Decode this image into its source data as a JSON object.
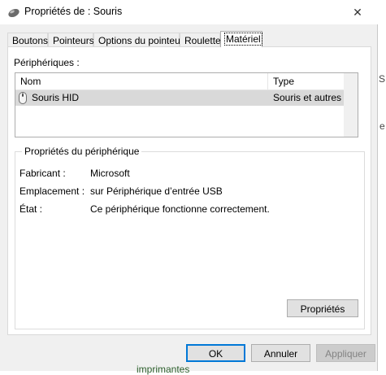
{
  "window": {
    "title": "Propriétés de : Souris",
    "close_glyph": "✕"
  },
  "tabs": [
    {
      "label": "Boutons",
      "active": false
    },
    {
      "label": "Pointeurs",
      "active": false
    },
    {
      "label": "Options du pointeur",
      "active": false
    },
    {
      "label": "Roulette",
      "active": false
    },
    {
      "label": "Matériel",
      "active": true
    }
  ],
  "devices": {
    "label": "Périphériques :",
    "columns": [
      "Nom",
      "Type"
    ],
    "rows": [
      {
        "name": "Souris HID",
        "type": "Souris et autres ...",
        "icon": "mouse-icon",
        "selected": true
      }
    ]
  },
  "properties": {
    "title": "Propriétés du périphérique",
    "fields": [
      {
        "key": "Fabricant :",
        "value": "Microsoft"
      },
      {
        "key": "Emplacement :",
        "value": "sur Périphérique d’entrée USB"
      },
      {
        "key": "État :",
        "value": "Ce périphérique fonctionne correctement."
      }
    ],
    "button": "Propriétés"
  },
  "footer": {
    "ok": "OK",
    "cancel": "Annuler",
    "apply": "Appliquer"
  },
  "background": {
    "fragment_1": "S",
    "fragment_2": "e",
    "fragment_3": "imprimantes"
  },
  "colors": {
    "accent": "#0078d7",
    "selection": "#d9d9d9"
  }
}
